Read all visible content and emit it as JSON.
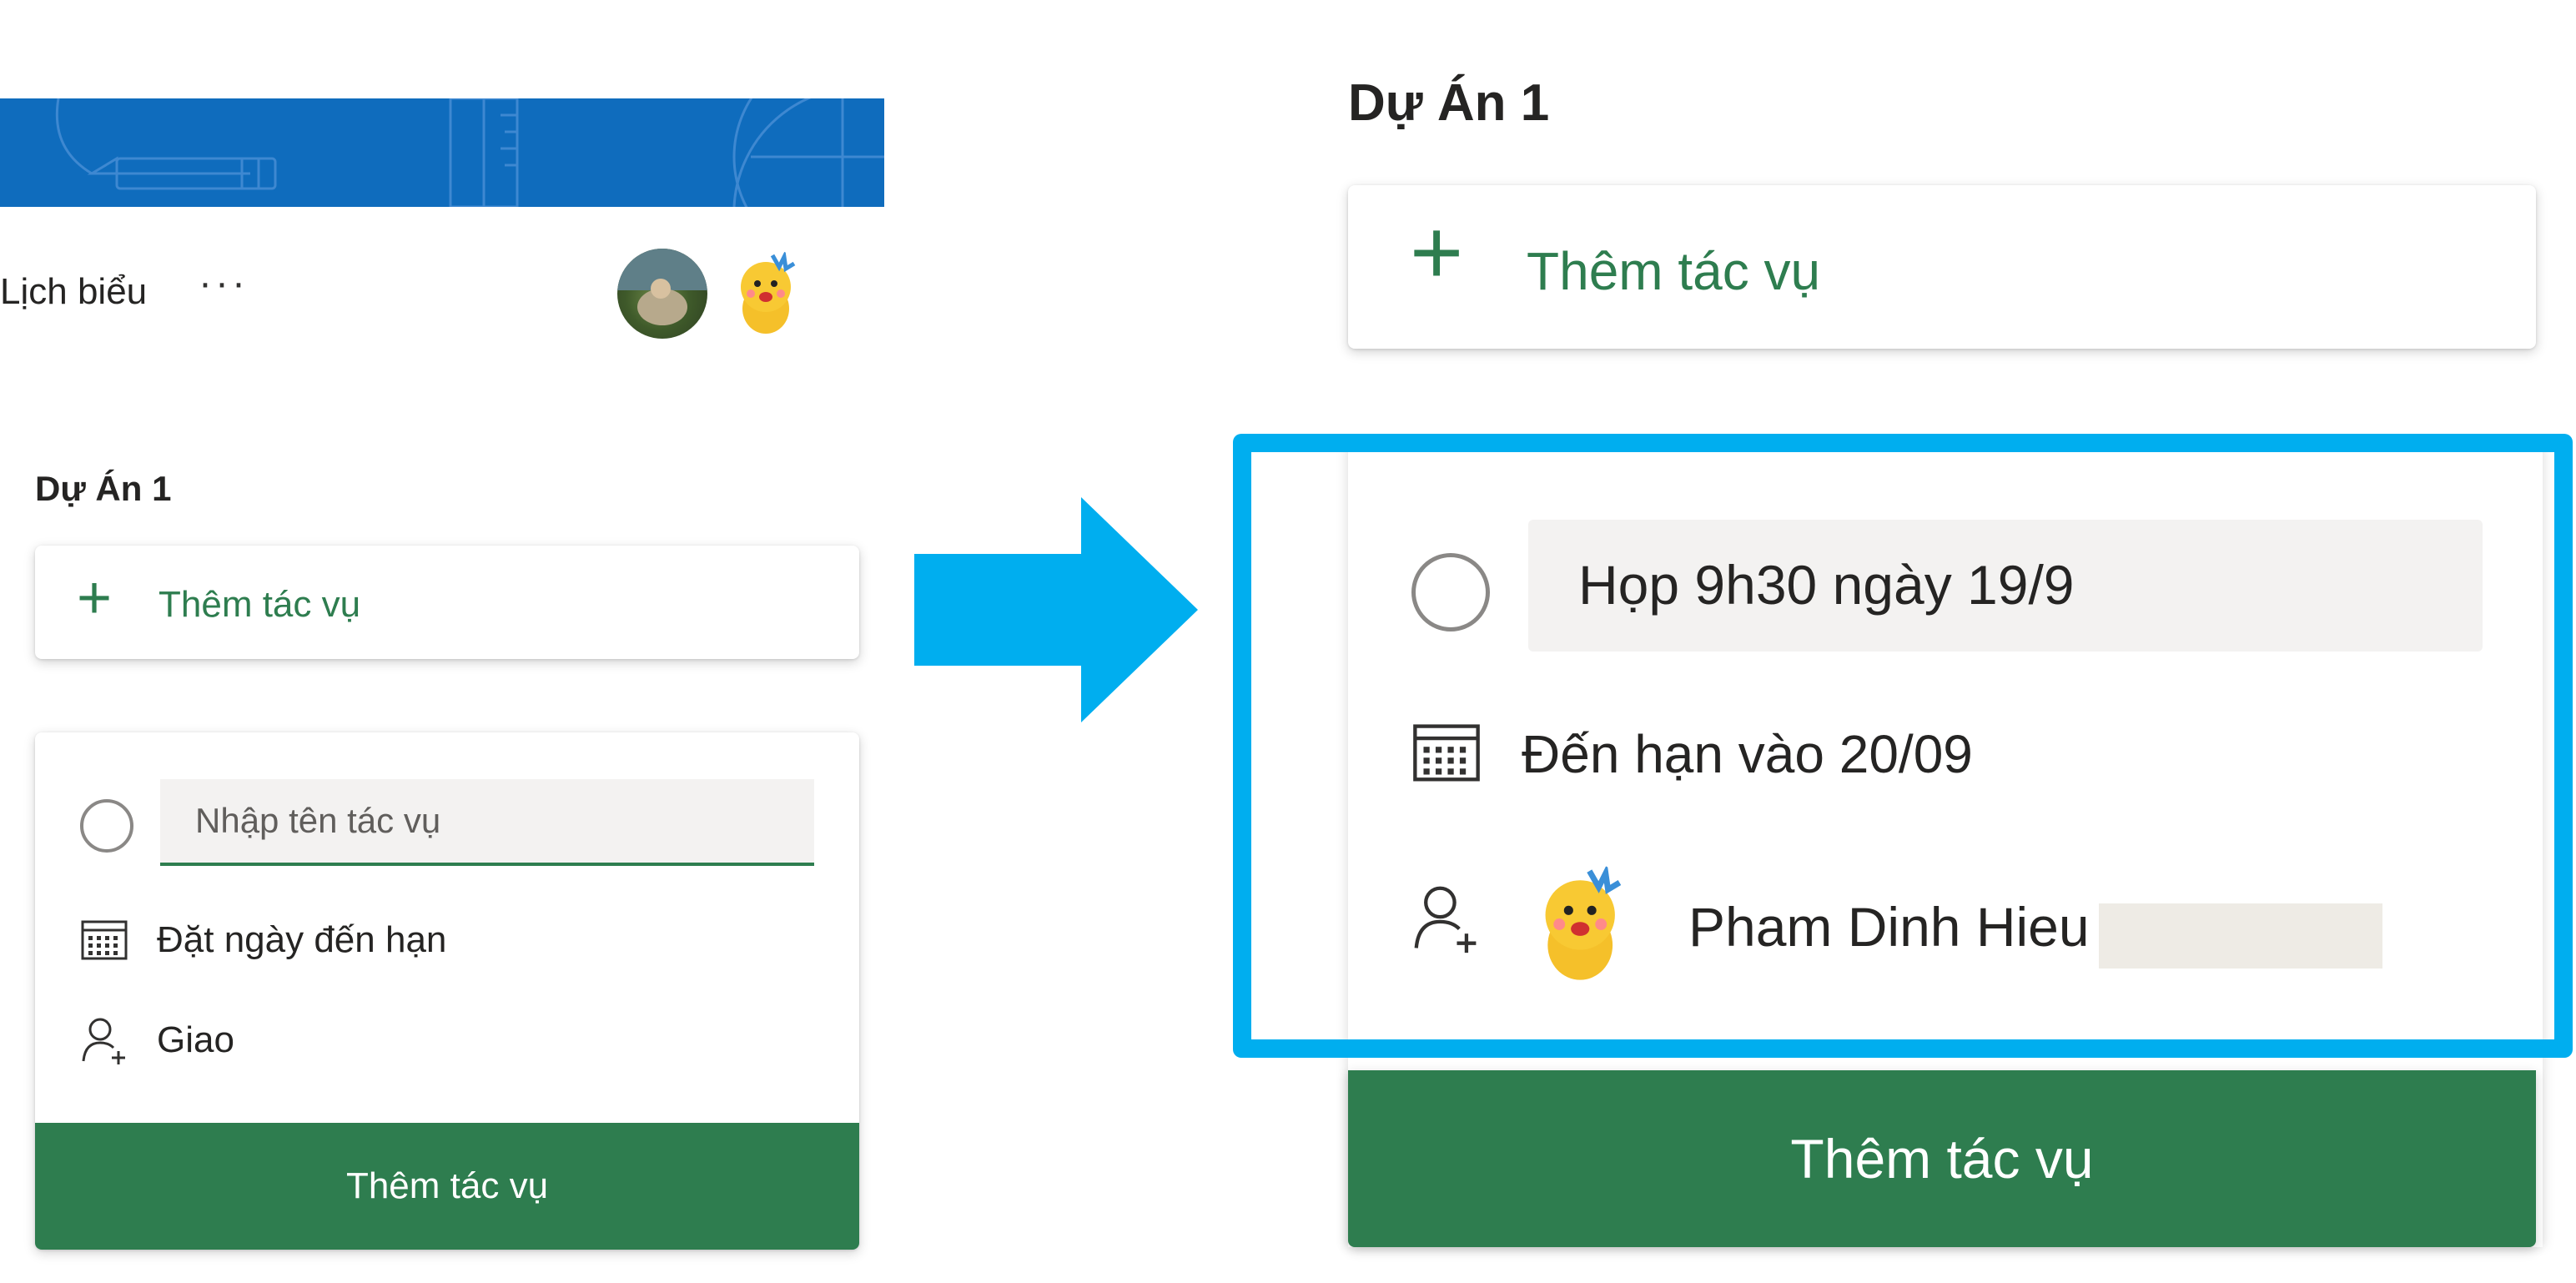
{
  "left": {
    "nav": {
      "schedule_label": "Lịch biểu",
      "more_label": "···"
    },
    "project_title": "Dự Án 1",
    "add_task_label": "Thêm tác vụ",
    "form": {
      "name_placeholder": "Nhập tên tác vụ",
      "due_label": "Đặt ngày đến hạn",
      "assign_label": "Giao",
      "submit_label": "Thêm tác vụ"
    }
  },
  "right": {
    "project_title": "Dự Án 1",
    "add_task_label": "Thêm tác vụ",
    "form": {
      "task_name": "Họp 9h30  ngày 19/9",
      "due_label": "Đến hạn vào 20/09",
      "assignee_name": "Pham Dinh Hieu",
      "submit_label": "Thêm tác vụ"
    }
  },
  "icons": {
    "add": "plus-icon",
    "checkbox": "circle-icon",
    "calendar": "calendar-icon",
    "assign": "person-add-icon",
    "arrow": "right-arrow-icon"
  },
  "colors": {
    "banner": "#0f6cbd",
    "accent_green": "#2e7d4f",
    "arrow_blue": "#00aeef",
    "input_bg": "#f3f2f1"
  }
}
